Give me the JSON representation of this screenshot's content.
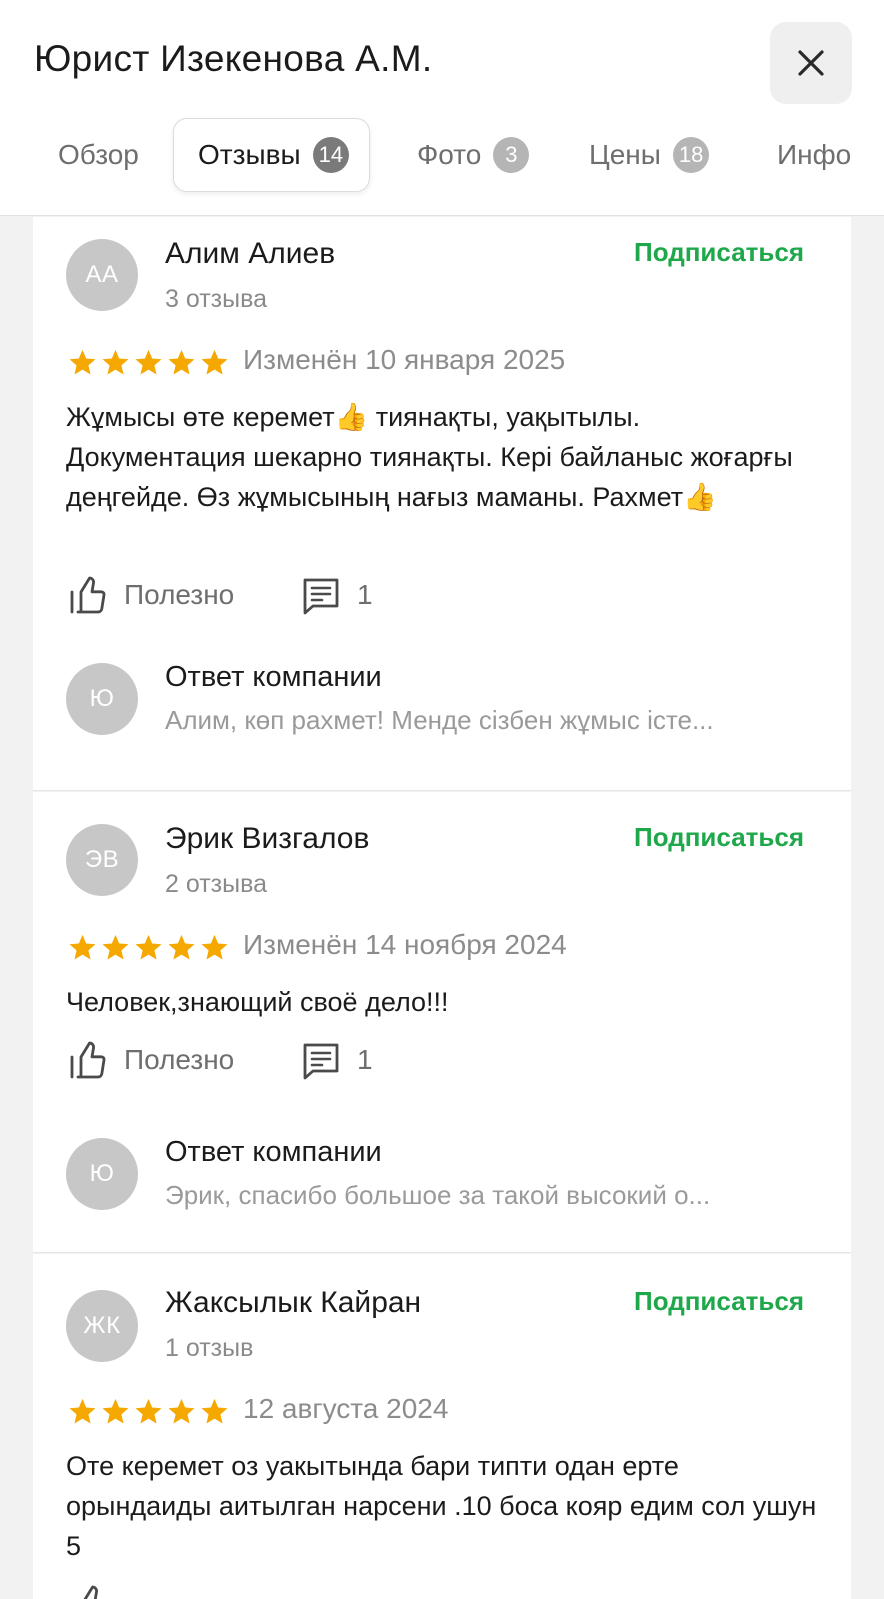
{
  "header": {
    "title": "Юрист Изекенова А.М.",
    "tabs": [
      {
        "label": "Обзор",
        "badge": ""
      },
      {
        "label": "Отзывы",
        "badge": "14"
      },
      {
        "label": "Фото",
        "badge": "3"
      },
      {
        "label": "Цены",
        "badge": "18"
      },
      {
        "label": "Инфо",
        "badge": ""
      }
    ]
  },
  "reviews": [
    {
      "initials": "АА",
      "author": "Алим Алиев",
      "count": "3 отзыва",
      "subscribe": "Подписаться",
      "rating": 5,
      "date": "Изменён 10 января 2025",
      "text": "Жұмысы өте керемет👍 тиянақты, уақытылы. Документация шекарно тиянақты. Кері байланыс жоғарғы деңгейде. Өз жұмысының нағыз маманы. Рахмет👍",
      "useful": "Полезно",
      "comments": "1",
      "reply_initial": "Ю",
      "reply_title": "Ответ компании",
      "reply_text": "Алим, көп рахмет! Менде сізбен жұмыс істе..."
    },
    {
      "initials": "ЭВ",
      "author": "Эрик Визгалов",
      "count": "2 отзыва",
      "subscribe": "Подписаться",
      "rating": 5,
      "date": "Изменён 14 ноября 2024",
      "text": "Человек,знающий своё дело!!!",
      "useful": "Полезно",
      "comments": "1",
      "reply_initial": "Ю",
      "reply_title": "Ответ компании",
      "reply_text": "Эрик, спасибо большое за такой высокий о..."
    },
    {
      "initials": "ЖК",
      "author": "Жаксылык Кайран",
      "count": "1 отзыв",
      "subscribe": "Подписаться",
      "rating": 5,
      "date": "12 августа 2024",
      "text": "Оте керемет оз уакытында бари типти одан ерте орындаиды аитылган нарсени .10 боса кояр едим сол ушун 5"
    }
  ],
  "colors": {
    "accent_green": "#1ea84a",
    "star": "#f5a800",
    "avatar_bg": "#c7c7c7"
  }
}
